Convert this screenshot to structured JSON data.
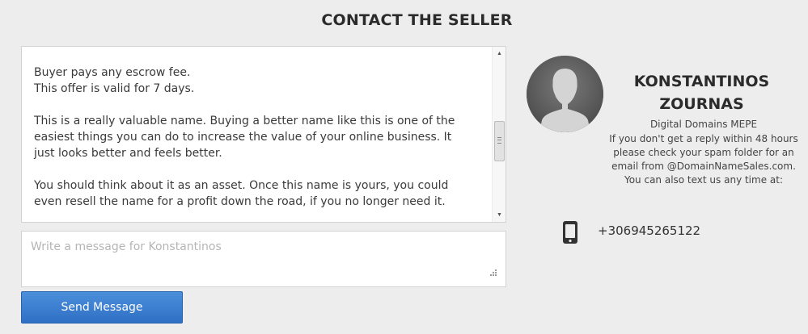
{
  "page": {
    "title": "CONTACT THE SELLER"
  },
  "message": {
    "paragraphs": [
      "Buyer pays any escrow fee.\nThis offer is valid for 7 days.",
      "This is a really valuable name. Buying a better name like this is one of the\neasiest things you can do to increase the value of your online business. It\njust looks better and feels better.",
      "You should think about it as an asset. Once this name is yours, you could\neven resell the name for a profit down the road, if you no longer need it."
    ]
  },
  "compose": {
    "placeholder": "Write a message for Konstantinos",
    "value": ""
  },
  "send_button": {
    "label": "Send Message"
  },
  "seller": {
    "name": "KONSTANTINOS ZOURNAS",
    "company": "Digital Domains MEPE",
    "note": "If you don't get a reply within 48 hours please check your spam folder for an email from @DomainNameSales.com. You can also text us any time at:",
    "phone": "+306945265122"
  },
  "icons": {
    "avatar": "user-silhouette-icon",
    "phone": "mobile-phone-icon",
    "scroll_up": "arrow-up-icon",
    "scroll_down": "arrow-down-icon",
    "resize": "resize-grip-icon"
  },
  "colors": {
    "button": "#3a7bd0",
    "background": "#ededed"
  }
}
